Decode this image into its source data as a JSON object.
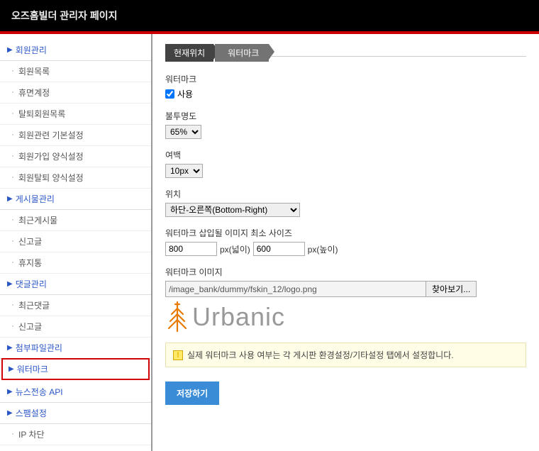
{
  "header": {
    "title": "오즈홈빌더 관리자 페이지"
  },
  "sidebar": {
    "sections": [
      {
        "label": "회원관리",
        "items": [
          "회원목록",
          "휴면계정",
          "탈퇴회원목록",
          "회원관련 기본설정",
          "회원가입 양식설정",
          "회원탈퇴 양식설정"
        ]
      },
      {
        "label": "게시물관리",
        "items": [
          "최근게시물",
          "신고글",
          "휴지통"
        ]
      },
      {
        "label": "댓글관리",
        "items": [
          "최근댓글",
          "신고글"
        ]
      },
      {
        "label": "첨부파일관리",
        "items": []
      },
      {
        "label": "워터마크",
        "items": [],
        "highlighted": true
      },
      {
        "label": "뉴스전송 API",
        "items": []
      },
      {
        "label": "스팸설정",
        "items": [
          "IP 차단"
        ]
      }
    ]
  },
  "breadcrumb": {
    "current": "현재위치",
    "page": "워터마크"
  },
  "form": {
    "watermark_label": "워터마크",
    "use_label": "사용",
    "use_checked": true,
    "opacity_label": "불투명도",
    "opacity_value": "65%",
    "margin_label": "여백",
    "margin_value": "10px",
    "position_label": "위치",
    "position_value": "하단-오른쪽(Bottom-Right)",
    "minsize_label": "워터마크 삽입될 이미지 최소 사이즈",
    "width_value": "800",
    "width_unit": "px(넓이)",
    "height_value": "600",
    "height_unit": "px(높이)",
    "image_label": "워터마크 이미지",
    "image_path": "/image_bank/dummy/fskin_12/logo.png",
    "browse_label": "찾아보기...",
    "logo_text": "Urbanic",
    "notice_text": "실제 워터마크 사용 여부는 각 게시판 환경설정/기타설정 탭에서 설정합니다.",
    "save_label": "저장하기"
  }
}
